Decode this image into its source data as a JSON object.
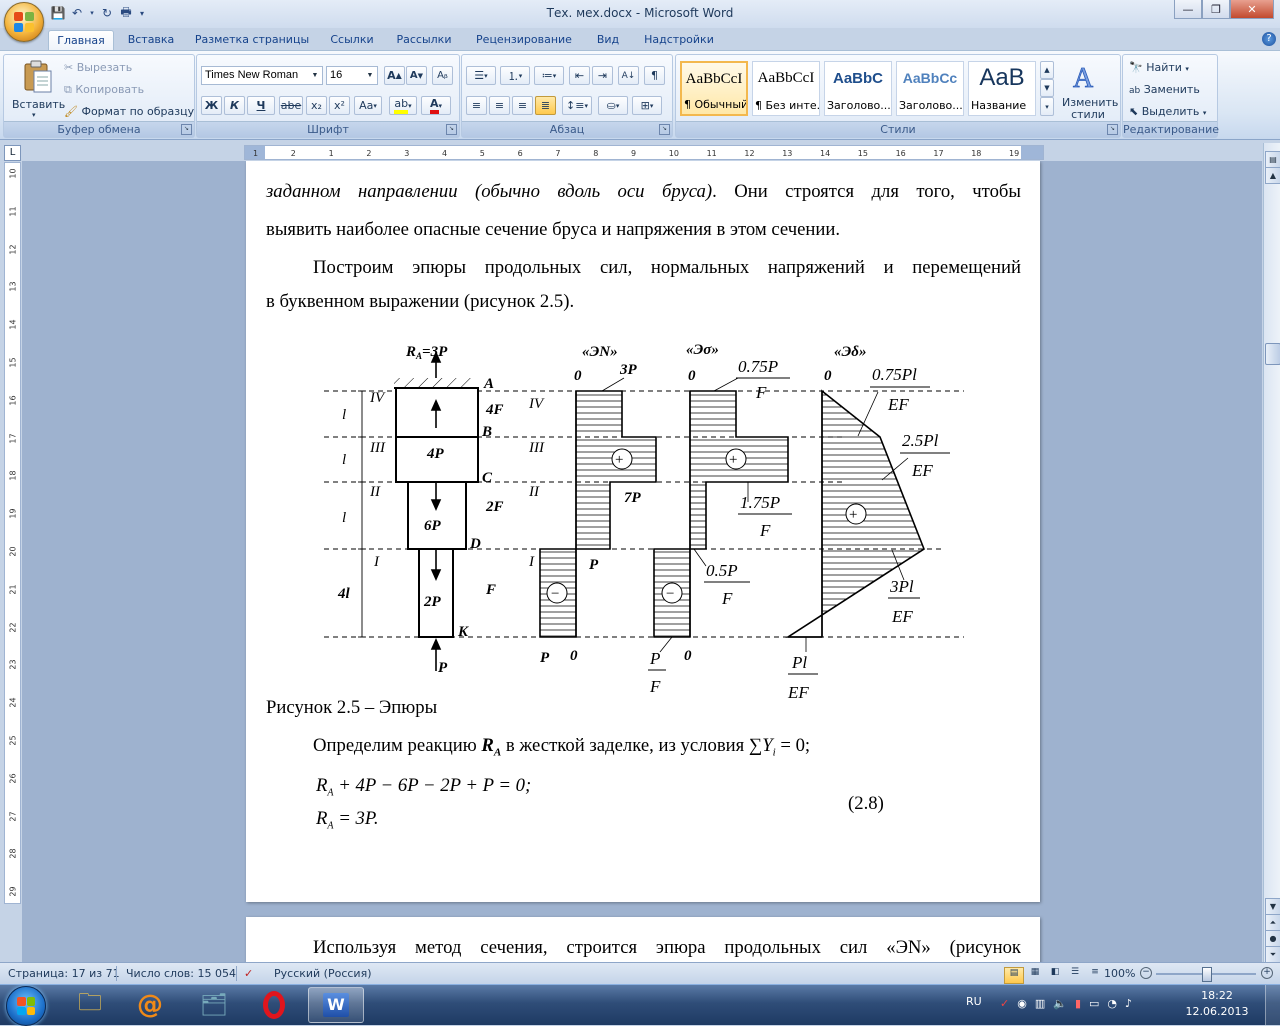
{
  "window": {
    "title": "Тех. мех.docx - Microsoft Word"
  },
  "tabs": [
    "Главная",
    "Вставка",
    "Разметка страницы",
    "Ссылки",
    "Рассылки",
    "Рецензирование",
    "Вид",
    "Надстройки"
  ],
  "clipboard": {
    "paste": "Вставить",
    "cut": "Вырезать",
    "copy": "Копировать",
    "format_painter": "Формат по образцу",
    "label": "Буфер обмена"
  },
  "font": {
    "name": "Times New Roman",
    "size": "16",
    "label": "Шрифт",
    "bold": "Ж",
    "italic": "К",
    "underline": "Ч",
    "strike": "abe",
    "sub": "x₂",
    "sup": "x²",
    "case": "Aa"
  },
  "paragraph": {
    "label": "Абзац"
  },
  "styles": {
    "label": "Стили",
    "items": [
      {
        "preview": "AaBbCcI",
        "name": "¶ Обычный"
      },
      {
        "preview": "AaBbCcI",
        "name": "¶ Без инте..."
      },
      {
        "preview": "AaBbC",
        "name": "Заголово..."
      },
      {
        "preview": "AaBbCc",
        "name": "Заголово..."
      },
      {
        "preview": "AaB",
        "name": "Название"
      }
    ],
    "change": "Изменить стили"
  },
  "editing": {
    "label": "Редактирование",
    "find": "Найти",
    "replace": "Заменить",
    "select": "Выделить"
  },
  "ruler": {
    "h_numbers": [
      "1",
      "2",
      "1",
      "2",
      "3",
      "4",
      "5",
      "6",
      "7",
      "8",
      "9",
      "10",
      "11",
      "12",
      "13",
      "14",
      "15",
      "16",
      "17",
      "18",
      "19"
    ],
    "v_numbers": [
      "10",
      "11",
      "12",
      "13",
      "14",
      "15",
      "16",
      "17",
      "18",
      "19",
      "20",
      "21",
      "22",
      "23",
      "24",
      "25",
      "26",
      "27",
      "28",
      "29"
    ]
  },
  "document": {
    "line1": "заданном направлении (обычно вдоль оси бруса). Они строятся для того, чтобы",
    "line1_italic": "заданном направлении (обычно вдоль оси бруса)",
    "line1_rest": ". Они строятся для того, чтобы",
    "line2": "выявить наиболее опасные сечение бруса и напряжения в этом сечении.",
    "line3": "Построим эпюры продольных сил, нормальных напряжений и перемещений",
    "line4": "в буквенном выражении (рисунок 2.5).",
    "caption": "Рисунок 2.5 –  Эпюры",
    "line5_a": "Определим реакцию ",
    "line5_ra": "R",
    "line5_ra_sub": "A",
    "line5_b": " в жесткой заделке, из условия ",
    "line5_eq": "∑Y",
    "line5_eq_sub": "i",
    "line5_eq_end": " = 0;",
    "eq1": "R",
    "eq1_sub": "A",
    "eq1_rest": " + 4P − 6P − 2P + P = 0;",
    "eq2": "R",
    "eq2_sub": "A",
    "eq2_rest": " = 3P.",
    "eq_num": "(2.8)",
    "page2_line": "Используя метод сечения, строится эпюра продольных сил «ЭN» (рисунок"
  },
  "figure": {
    "ra": "R",
    "ra_sub": "A",
    "ra_rest": "=3P",
    "titles": [
      "«ЭN»",
      "«Эσ»",
      "«Эδ»"
    ],
    "points": [
      "A",
      "B",
      "C",
      "D",
      "K"
    ],
    "sections": [
      "IV",
      "III",
      "II",
      "I"
    ],
    "lengths": [
      "l",
      "l",
      "l",
      "4l"
    ],
    "areas": [
      "4F",
      "2F",
      "F"
    ],
    "forces": [
      "4P",
      "6P",
      "2P",
      "P"
    ],
    "n_labels": [
      "0",
      "3P",
      "7P",
      "P",
      "P",
      "0"
    ],
    "s_labels": [
      "0",
      "0.75P",
      "F",
      "1.75P",
      "F",
      "0.5P",
      "F",
      "P",
      "F",
      "0"
    ],
    "d_labels": [
      "0",
      "0.75Pl",
      "EF",
      "2.5Pl",
      "EF",
      "3Pl",
      "EF",
      "Pl",
      "EF"
    ],
    "plus": "+",
    "minus": "−"
  },
  "status": {
    "page": "Страница: 17 из 71",
    "words": "Число слов: 15 054",
    "lang": "Русский (Россия)",
    "zoom": "100%"
  },
  "tray": {
    "lang": "RU",
    "time": "18:22",
    "date": "12.06.2013"
  }
}
